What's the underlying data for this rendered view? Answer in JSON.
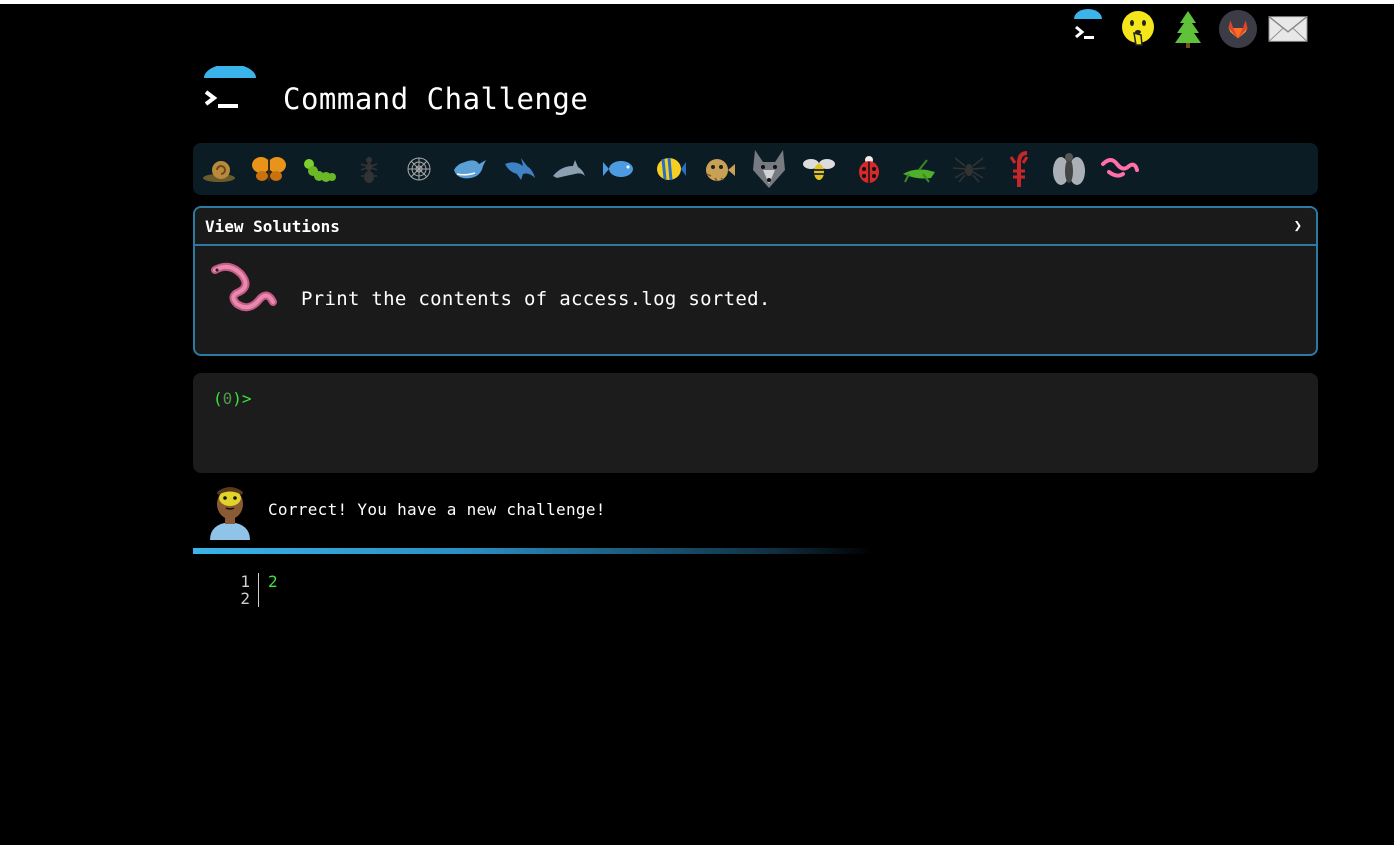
{
  "page": {
    "title": "Command Challenge"
  },
  "nav": [
    {
      "name": "home-terminal-icon"
    },
    {
      "name": "shush-emoji-icon"
    },
    {
      "name": "tree-icon"
    },
    {
      "name": "gitlab-icon"
    },
    {
      "name": "mail-icon"
    }
  ],
  "levels": [
    {
      "icon": "snail-icon"
    },
    {
      "icon": "butterfly-icon"
    },
    {
      "icon": "caterpillar-icon"
    },
    {
      "icon": "ant-icon"
    },
    {
      "icon": "spider-web-icon"
    },
    {
      "icon": "whale-icon"
    },
    {
      "icon": "shark-icon"
    },
    {
      "icon": "dolphin-icon"
    },
    {
      "icon": "fish-icon"
    },
    {
      "icon": "tropical-fish-icon"
    },
    {
      "icon": "blowfish-icon"
    },
    {
      "icon": "wolf-icon"
    },
    {
      "icon": "bee-icon"
    },
    {
      "icon": "ladybug-icon"
    },
    {
      "icon": "cricket-icon"
    },
    {
      "icon": "spider-icon"
    },
    {
      "icon": "scorpion-icon"
    },
    {
      "icon": "fly-icon"
    },
    {
      "icon": "worm-icon"
    }
  ],
  "colors": {
    "accent": "#2a7aa3",
    "prompt": "#39e639",
    "progress": "#3ab4ea"
  },
  "challenge": {
    "solutions_label": "View Solutions",
    "chevron": "❯",
    "icon": "worm-icon",
    "text": "Print the contents of access.log sorted."
  },
  "terminal": {
    "prompt_open": "(",
    "prompt_num": "0",
    "prompt_close": ")>",
    "value": ""
  },
  "feedback": {
    "avatar": "bearded-person-icon",
    "text": "Correct! You have a new challenge!"
  },
  "output": {
    "line_numbers": "1\n2",
    "lines": "2\n"
  }
}
